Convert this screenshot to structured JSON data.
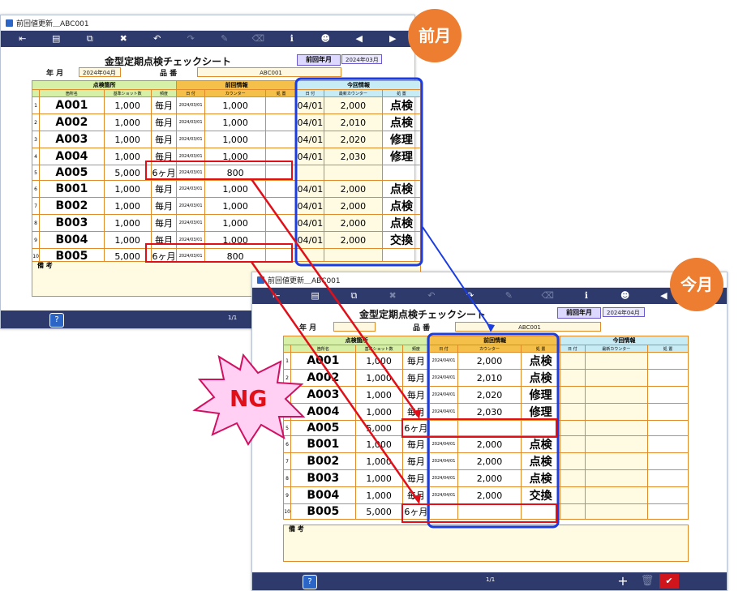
{
  "window_prev": {
    "title": "前回値更新＿ABC001",
    "sheet_title": "金型定期点検チェックシート",
    "prev_label": "前回年月",
    "prev_value": "2024年03月",
    "year_month_label": "年 月",
    "year_month_value": "2024年04月",
    "product_label": "品 番",
    "product_value": "ABC001",
    "remarks_label": "備 考",
    "page": "1/1",
    "help": "?"
  },
  "window_cur": {
    "title": "前回値更新＿ABC001",
    "sheet_title": "金型定期点検チェックシート",
    "prev_label": "前回年月",
    "prev_value": "2024年04月",
    "year_month_label": "年 月",
    "product_label": "品 番",
    "product_value": "ABC001",
    "remarks_label": "備 考",
    "page": "1/1",
    "help": "?"
  },
  "headers": {
    "group1": "点検箇所",
    "group2": "前回情報",
    "group3": "今回情報",
    "loc": "箇所名",
    "shots": "基準ショット数",
    "freq": "頻度",
    "date": "日 付",
    "counter": "カウンター",
    "action": "処 置",
    "latest_counter": "最新カウンター"
  },
  "rows_prev": [
    {
      "n": "1",
      "loc": "A001",
      "shots": "1,000",
      "freq": "毎月",
      "pdate": "2024/03/01",
      "pcount": "1,000",
      "paction": "",
      "cdate": "04/01",
      "ccount": "2,000",
      "caction": "点検"
    },
    {
      "n": "2",
      "loc": "A002",
      "shots": "1,000",
      "freq": "毎月",
      "pdate": "2024/03/01",
      "pcount": "1,000",
      "paction": "",
      "cdate": "04/01",
      "ccount": "2,010",
      "caction": "点検"
    },
    {
      "n": "3",
      "loc": "A003",
      "shots": "1,000",
      "freq": "毎月",
      "pdate": "2024/03/01",
      "pcount": "1,000",
      "paction": "",
      "cdate": "04/01",
      "ccount": "2,020",
      "caction": "修理"
    },
    {
      "n": "4",
      "loc": "A004",
      "shots": "1,000",
      "freq": "毎月",
      "pdate": "2024/03/01",
      "pcount": "1,000",
      "paction": "",
      "cdate": "04/01",
      "ccount": "2,030",
      "caction": "修理"
    },
    {
      "n": "5",
      "loc": "A005",
      "shots": "5,000",
      "freq": "6ヶ月",
      "pdate": "2024/03/01",
      "pcount": "800",
      "paction": "",
      "cdate": "",
      "ccount": "",
      "caction": ""
    },
    {
      "n": "6",
      "loc": "B001",
      "shots": "1,000",
      "freq": "毎月",
      "pdate": "2024/03/01",
      "pcount": "1,000",
      "paction": "",
      "cdate": "04/01",
      "ccount": "2,000",
      "caction": "点検"
    },
    {
      "n": "7",
      "loc": "B002",
      "shots": "1,000",
      "freq": "毎月",
      "pdate": "2024/03/01",
      "pcount": "1,000",
      "paction": "",
      "cdate": "04/01",
      "ccount": "2,000",
      "caction": "点検"
    },
    {
      "n": "8",
      "loc": "B003",
      "shots": "1,000",
      "freq": "毎月",
      "pdate": "2024/03/01",
      "pcount": "1,000",
      "paction": "",
      "cdate": "04/01",
      "ccount": "2,000",
      "caction": "点検"
    },
    {
      "n": "9",
      "loc": "B004",
      "shots": "1,000",
      "freq": "毎月",
      "pdate": "2024/03/01",
      "pcount": "1,000",
      "paction": "",
      "cdate": "04/01",
      "ccount": "2,000",
      "caction": "交換"
    },
    {
      "n": "10",
      "loc": "B005",
      "shots": "5,000",
      "freq": "6ヶ月",
      "pdate": "2024/03/01",
      "pcount": "800",
      "paction": "",
      "cdate": "",
      "ccount": "",
      "caction": ""
    }
  ],
  "rows_cur": [
    {
      "n": "1",
      "loc": "A001",
      "shots": "1,000",
      "freq": "毎月",
      "pdate": "2024/04/01",
      "pcount": "2,000",
      "paction": "点検"
    },
    {
      "n": "2",
      "loc": "A002",
      "shots": "1,000",
      "freq": "毎月",
      "pdate": "2024/04/01",
      "pcount": "2,010",
      "paction": "点検"
    },
    {
      "n": "3",
      "loc": "A003",
      "shots": "1,000",
      "freq": "毎月",
      "pdate": "2024/04/01",
      "pcount": "2,020",
      "paction": "修理"
    },
    {
      "n": "4",
      "loc": "A004",
      "shots": "1,000",
      "freq": "毎月",
      "pdate": "2024/04/01",
      "pcount": "2,030",
      "paction": "修理"
    },
    {
      "n": "5",
      "loc": "A005",
      "shots": "5,000",
      "freq": "6ヶ月",
      "pdate": "",
      "pcount": "",
      "paction": ""
    },
    {
      "n": "6",
      "loc": "B001",
      "shots": "1,000",
      "freq": "毎月",
      "pdate": "2024/04/01",
      "pcount": "2,000",
      "paction": "点検"
    },
    {
      "n": "7",
      "loc": "B002",
      "shots": "1,000",
      "freq": "毎月",
      "pdate": "2024/04/01",
      "pcount": "2,000",
      "paction": "点検"
    },
    {
      "n": "8",
      "loc": "B003",
      "shots": "1,000",
      "freq": "毎月",
      "pdate": "2024/04/01",
      "pcount": "2,000",
      "paction": "点検"
    },
    {
      "n": "9",
      "loc": "B004",
      "shots": "1,000",
      "freq": "毎月",
      "pdate": "2024/04/01",
      "pcount": "2,000",
      "paction": "交換"
    },
    {
      "n": "10",
      "loc": "B005",
      "shots": "5,000",
      "freq": "6ヶ月",
      "pdate": "",
      "pcount": "",
      "paction": ""
    }
  ],
  "annotations": {
    "prev_month": "前月",
    "this_month": "今月",
    "ng": "NG"
  },
  "colors": {
    "toolbar": "#2e3a6b",
    "orange": "#ed7d31",
    "red": "#e0101a",
    "blue": "#1a3ce0",
    "ng_burst": "#ffcaf0"
  }
}
